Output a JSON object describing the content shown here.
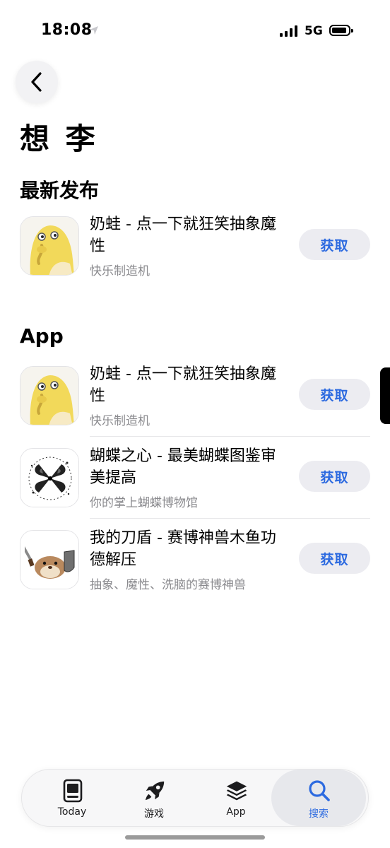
{
  "status": {
    "time": "18:08",
    "network": "5G"
  },
  "page": {
    "title": "想 李"
  },
  "sections": {
    "latest": {
      "title": "最新发布",
      "apps": [
        {
          "name": "奶蛙 - 点一下就狂笑抽象魔性",
          "subtitle": "快乐制造机",
          "button": "获取",
          "icon": "frog-icon"
        }
      ]
    },
    "apps": {
      "title": "App",
      "apps": [
        {
          "name": "奶蛙 - 点一下就狂笑抽象魔性",
          "subtitle": "快乐制造机",
          "button": "获取",
          "icon": "frog-icon"
        },
        {
          "name": "蝴蝶之心 - 最美蝴蝶图鉴审美提高",
          "subtitle": "你的掌上蝴蝶博物馆",
          "button": "获取",
          "icon": "butterfly-icon"
        },
        {
          "name": "我的刀盾 - 赛博神兽木鱼功德解压",
          "subtitle": "抽象、魔性、洗脑的赛博神兽",
          "button": "获取",
          "icon": "hamster-sword-shield-icon"
        }
      ]
    }
  },
  "tabbar": {
    "items": [
      {
        "label": "Today",
        "icon": "today-icon",
        "active": false
      },
      {
        "label": "游戏",
        "icon": "rocket-icon",
        "active": false
      },
      {
        "label": "App",
        "icon": "layers-icon",
        "active": false
      },
      {
        "label": "搜索",
        "icon": "search-icon",
        "active": true
      }
    ]
  },
  "colors": {
    "accent": "#2c6ae0",
    "button_bg": "#ececf1",
    "subtitle": "#8a8a8e"
  }
}
